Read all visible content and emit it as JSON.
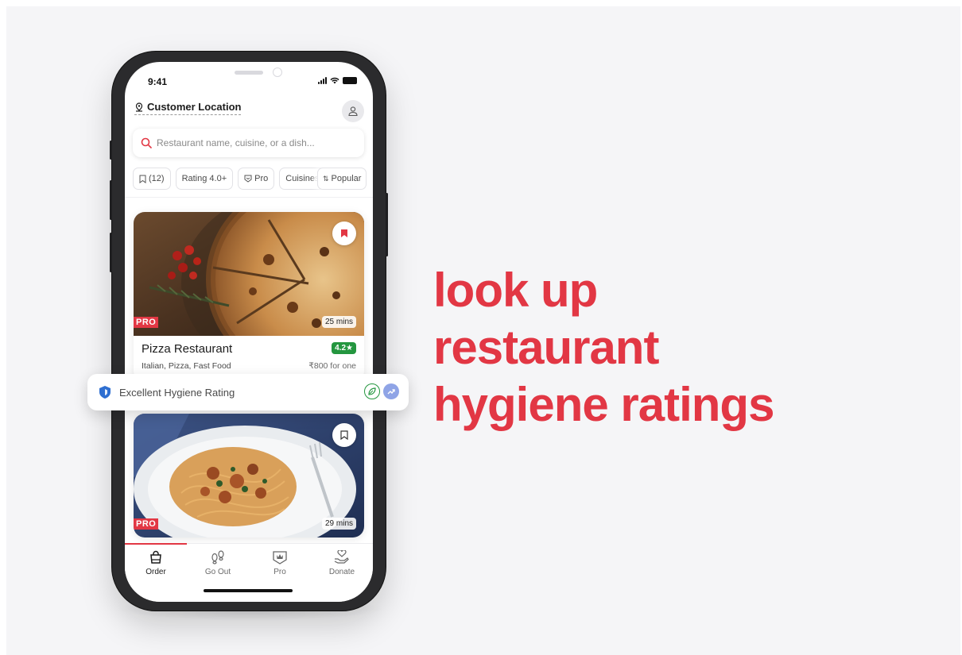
{
  "status_bar": {
    "time": "9:41"
  },
  "header": {
    "location": "Customer Location"
  },
  "search": {
    "placeholder": "Restaurant name, cuisine, or a dish..."
  },
  "filters": {
    "saved": "(12)",
    "rating": "Rating 4.0+",
    "pro": "Pro",
    "cuisines": "Cuisines",
    "popular": "Popular"
  },
  "restaurants": [
    {
      "name": "Pizza Restaurant",
      "rating": "4.2★",
      "cuisine": "Italian, Pizza, Fast Food",
      "price": "₹800 for one",
      "pro": "PRO",
      "delivery_time": "25 mins",
      "bookmarked": true
    },
    {
      "pro": "PRO",
      "delivery_time": "29 mins",
      "bookmarked": false
    }
  ],
  "hygiene": {
    "label": "Excellent Hygiene Rating"
  },
  "tabs": [
    {
      "label": "Order",
      "icon": "shopping-bag-icon",
      "active": true
    },
    {
      "label": "Go Out",
      "icon": "footsteps-icon",
      "active": false
    },
    {
      "label": "Pro",
      "icon": "crown-badge-icon",
      "active": false
    },
    {
      "label": "Donate",
      "icon": "heart-hand-icon",
      "active": false
    }
  ],
  "headline": {
    "line1": "look up",
    "line2": "restaurant",
    "line3": "hygiene ratings"
  },
  "colors": {
    "brand": "#e23744",
    "rating_green": "#24963f",
    "background": "#f5f5f7"
  }
}
